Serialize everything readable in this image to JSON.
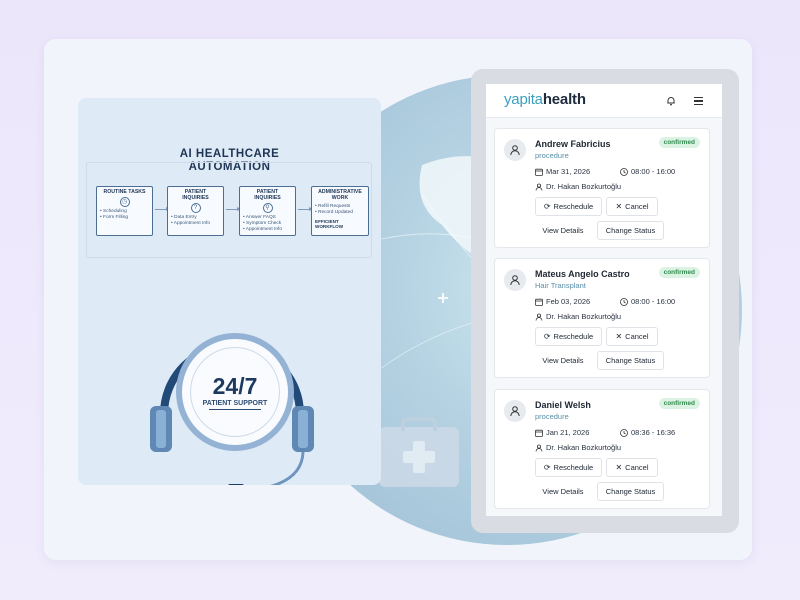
{
  "infographic": {
    "title_line1": "AI HEALTHCARE",
    "title_line2": "AUTOMATION",
    "steps": [
      {
        "title": "ROUTINE TASKS",
        "items": [
          "• Scheduling",
          "• Form Filling"
        ],
        "icon": "clock-icon"
      },
      {
        "title": "PATIENT INQUIRIES",
        "items": [
          "• Data Entry",
          "• Appointment Info"
        ],
        "icon": "question-icon"
      },
      {
        "title": "PATIENT INQUIRIES",
        "items": [
          "• Answer FAQS",
          "• Symptom Check",
          "• Appointment Info"
        ],
        "icon": "magnifier-icon"
      },
      {
        "title": "ADMINISTRATIVE WORK",
        "items": [
          "• Refill Requests",
          "• Record Updated"
        ],
        "icon": "database-icon"
      }
    ],
    "efficient": "EFFICIENT WORKFLOW",
    "support_number": "24/7",
    "support_label": "PATIENT SUPPORT"
  },
  "app": {
    "logo_light": "yapita",
    "logo_bold": "health",
    "icons": {
      "notifications": "bell-icon",
      "menu": "hamburger-icon"
    },
    "appointments": [
      {
        "name": "Andrew Fabricius",
        "type": "procedure",
        "status": "confirmed",
        "date": "Mar 31, 2026",
        "time": "08:00 - 16:00",
        "doctor": "Dr. Hakan Bozkurtoğlu"
      },
      {
        "name": "Mateus Angelo Castro",
        "type": "Hair Transplant",
        "status": "confirmed",
        "date": "Feb 03, 2026",
        "time": "08:00 - 16:00",
        "doctor": "Dr. Hakan Bozkurtoğlu"
      },
      {
        "name": "Daniel Welsh",
        "type": "procedure",
        "status": "confirmed",
        "date": "Jan 21, 2026",
        "time": "08:36 - 16:36",
        "doctor": "Dr. Hakan Bozkurtoğlu"
      }
    ],
    "buttons": {
      "reschedule": "Reschedule",
      "cancel": "Cancel",
      "details": "View Details",
      "change_status": "Change Status"
    }
  },
  "colors": {
    "brand": "#3a9fc0",
    "badge_bg": "#dcf3e4",
    "badge_text": "#2f8a4e",
    "navy": "#1c3a5f"
  }
}
